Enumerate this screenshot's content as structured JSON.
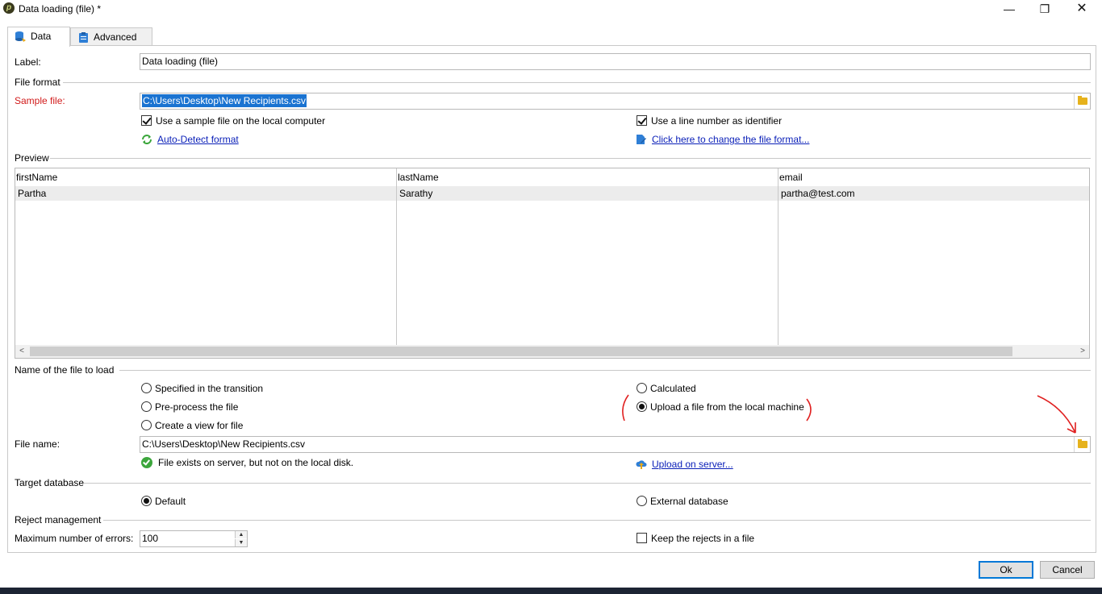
{
  "window": {
    "title": "Data loading (file) *",
    "app_icon": "p",
    "minimize_glyph": "—",
    "maximize_glyph": "❐",
    "close_glyph": "✕"
  },
  "tabs": [
    {
      "label": "Data",
      "icon": "database-icon",
      "active": true
    },
    {
      "label": "Advanced",
      "icon": "clipboard-icon",
      "active": false
    }
  ],
  "label_field": {
    "label": "Label:",
    "value": "Data loading (file)"
  },
  "file_format": {
    "section_title": "File format",
    "sample_file_label": "Sample file:",
    "sample_file_value": "C:\\Users\\Desktop\\New Recipients.csv",
    "use_sample_local_label": "Use a sample file on the local computer",
    "use_sample_local_checked": true,
    "use_line_number_label": "Use a line number as identifier",
    "use_line_number_checked": true,
    "auto_detect_label": "Auto-Detect format",
    "change_format_label": "Click here to change the file format..."
  },
  "preview": {
    "section_title": "Preview",
    "columns": [
      "firstName",
      "lastName",
      "email"
    ],
    "rows": [
      [
        "Partha",
        "Sarathy",
        "partha@test.com"
      ]
    ],
    "scroll_left": "<",
    "scroll_right": ">"
  },
  "file_to_load": {
    "section_title": "Name of the file to load",
    "options": [
      {
        "label": "Specified in the transition",
        "selected": false
      },
      {
        "label": "Pre-process the file",
        "selected": false
      },
      {
        "label": "Create a view for file",
        "selected": false
      },
      {
        "label": "Calculated",
        "selected": false
      },
      {
        "label": "Upload a file from the local machine",
        "selected": true
      }
    ],
    "file_name_label": "File name:",
    "file_name_value": "C:\\Users\\Desktop\\New Recipients.csv",
    "status_text": "File exists on server, but not on the local disk.",
    "upload_label": "Upload on server..."
  },
  "target_database": {
    "section_title": "Target database",
    "default_label": "Default",
    "default_selected": true,
    "external_label": "External database",
    "external_selected": false
  },
  "reject_management": {
    "section_title": "Reject management",
    "max_errors_label": "Maximum number of errors:",
    "max_errors_value": "100",
    "keep_rejects_label": "Keep the rejects in a file",
    "keep_rejects_checked": false
  },
  "buttons": {
    "ok": "Ok",
    "cancel": "Cancel"
  },
  "colors": {
    "accent": "#0078d7",
    "required_label": "#d11a1a",
    "link": "#0a1fb8",
    "annotation": "#e02020"
  }
}
